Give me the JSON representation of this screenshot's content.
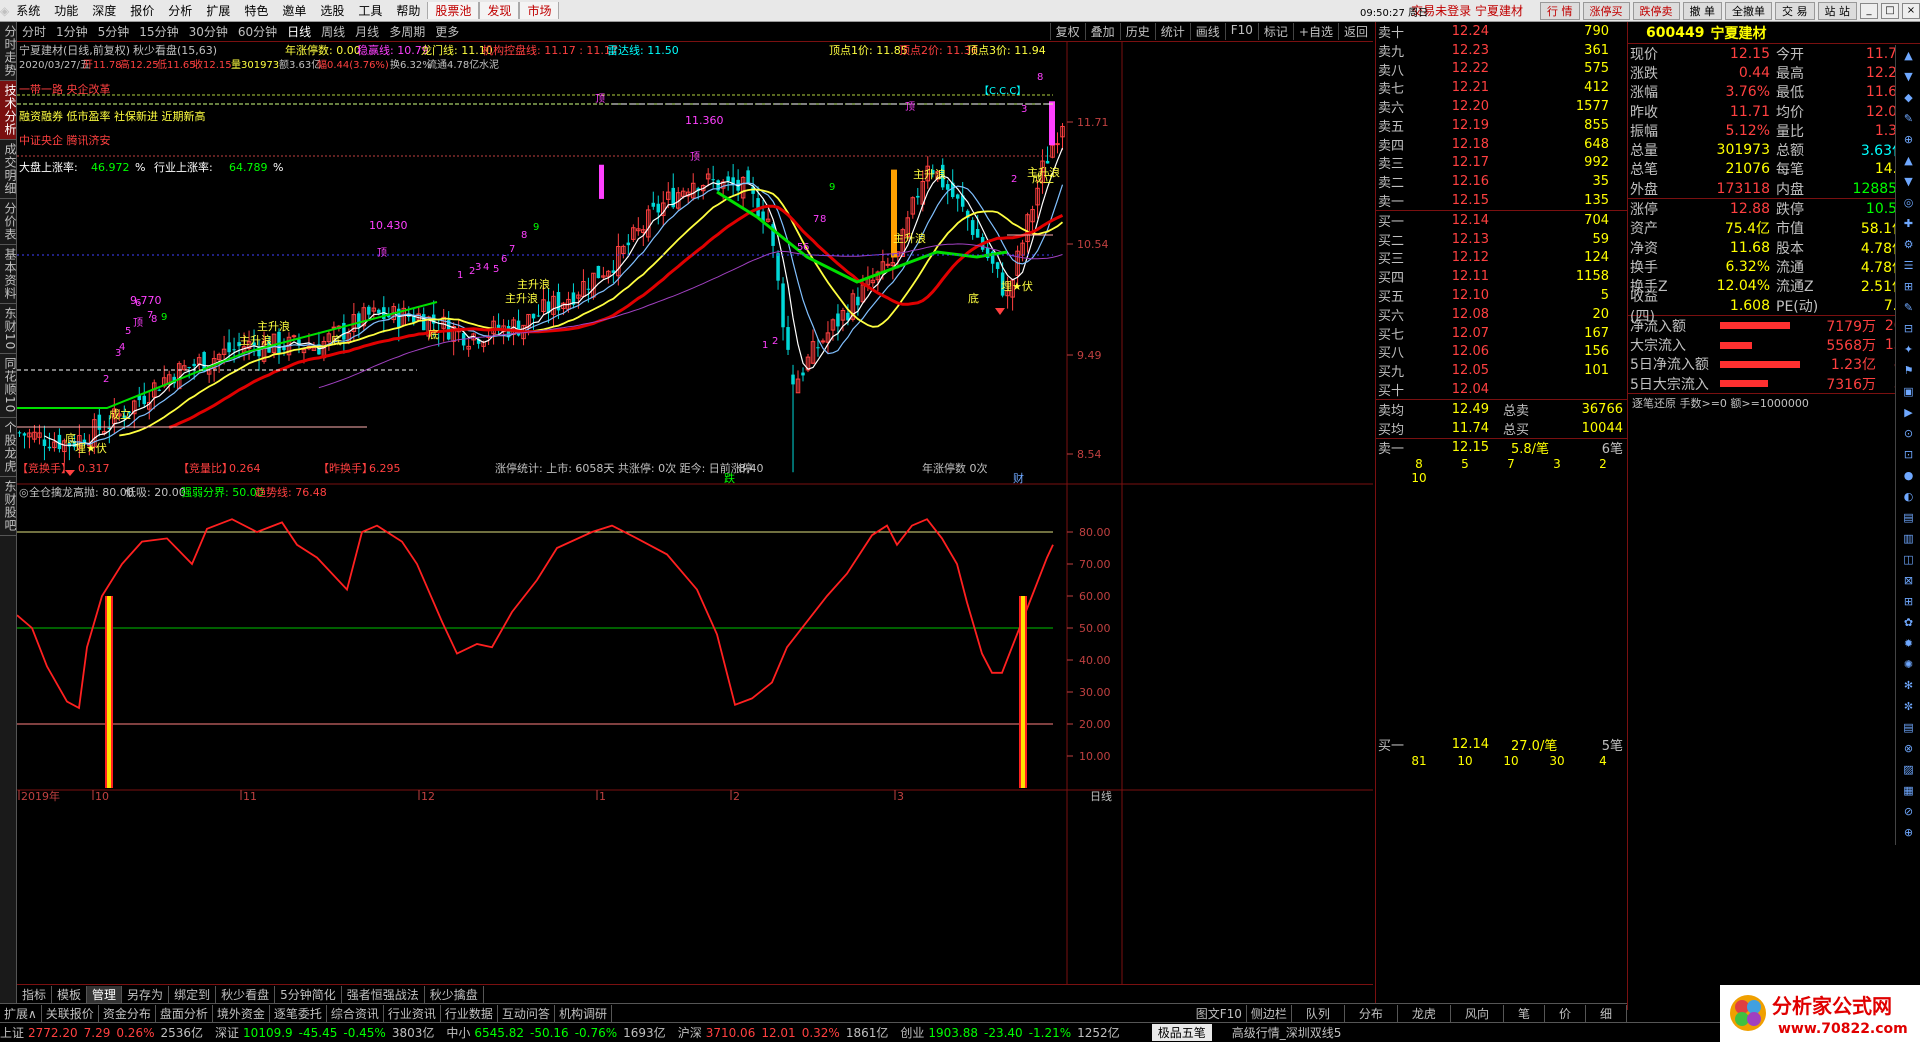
{
  "menu": {
    "items": [
      "系统",
      "功能",
      "深度",
      "报价",
      "分析",
      "扩展",
      "特色",
      "邀单",
      "选股",
      "工具",
      "帮助"
    ],
    "red_tabs": [
      "股票池",
      "发现",
      "市场"
    ],
    "status": "交易未登录 宁夏建材",
    "toolbar": [
      "行 情",
      "涨停买",
      "跌停卖",
      "撤 单",
      "全撤单",
      "交 易",
      "站 站"
    ],
    "clock": "09:50:27 周日"
  },
  "left_tabs": [
    "分时走势",
    "技术分析",
    "成交明细",
    "分价表",
    "基本资料",
    "东财10",
    "同花顺10",
    "个股龙虎",
    "东财股吧"
  ],
  "period_bar": {
    "periods": [
      "分时",
      "1分钟",
      "5分钟",
      "15分钟",
      "30分钟",
      "60分钟",
      "日线",
      "周线",
      "月线",
      "多周期",
      "更多"
    ],
    "selected": "日线",
    "right": [
      "复权",
      "叠加",
      "历史",
      "统计",
      "画线",
      "F10",
      "标记",
      "+自选",
      "返回"
    ]
  },
  "chart_header": {
    "title": "宁夏建材(日线,前复权)",
    "indicator": "秋少看盘(15,63)",
    "yr_limit": "年涨停数: 0.00",
    "stable": "稳赢线: 10.79",
    "dragon": "龙门线: 11.10",
    "inst": "机构控盘线: 11.17 : 11.17",
    "radar": "雷达线: 11.50",
    "top1": "顶点1价: 11.85",
    "top2": "顶点2价: 11.36",
    "top3": "顶点3价: 11.94",
    "date_line": "2020/03/27/五",
    "ohlc_open": "开11.78",
    "ohlc_high": "高12.25",
    "ohlc_low": "低11.65",
    "ohlc_close": "收12.15",
    "vol": "量301973",
    "amt": "额3.63亿",
    "chg": "幅0.44(3.76%)",
    "turn": "换6.32%",
    "float": "流通4.78亿",
    "sector": "水泥"
  },
  "concepts": {
    "line1": "一带一路 央企改革",
    "line2": "融资融券 低市盈率 社保新进 近期新高",
    "line3": "中证央企 腾讯济安",
    "market_up_label": "大盘上涨率:",
    "market_up": "46.972",
    "pct": "%",
    "industry_up_label": "行业上涨率:",
    "industry_up": "64.789"
  },
  "chart_notes": {
    "jing": "【竞换手】",
    "jing_v": "0.317",
    "liang": "【竞量比】",
    "liang_v": "0.264",
    "zuo": "【昨换手】",
    "zuo_v": "6.295",
    "stats": "涨停统计: 上市: 6058天 共涨停: 0次 距今: 日前涨停",
    "yr": "年涨停数 0次",
    "cai": "财",
    "die": "跌",
    "low": "8.40",
    "ceiling": "11.360",
    "p1": "10.430",
    "p2": "9.770",
    "badge": "【C.C.C】"
  },
  "main_axis": {
    "labels": [
      "11.71",
      "10.54",
      "9.49",
      "8.54"
    ]
  },
  "labels": {
    "zhushenglang": "主升浪",
    "di": "底",
    "ding": "顶",
    "chengli": "成立",
    "maifu": "埋★伏"
  },
  "sub_header": {
    "name": "全仓擒龙",
    "high": "高抛: 80.00",
    "low": "低吸: 20.00",
    "split": "强弱分界: 50.00",
    "trend": "趋势线: 76.48"
  },
  "sub_axis": {
    "labels": [
      "80.00",
      "70.00",
      "60.00",
      "50.00",
      "40.00",
      "30.00",
      "20.00",
      "10.00"
    ]
  },
  "x_axis": {
    "labels": [
      "2019年",
      "10",
      "11",
      "12",
      "1",
      "2",
      "3"
    ],
    "right": "日线"
  },
  "order_book": {
    "sells": [
      {
        "l": "卖十",
        "p": "12.24",
        "v": "790"
      },
      {
        "l": "卖九",
        "p": "12.23",
        "v": "361"
      },
      {
        "l": "卖八",
        "p": "12.22",
        "v": "575"
      },
      {
        "l": "卖七",
        "p": "12.21",
        "v": "412"
      },
      {
        "l": "卖六",
        "p": "12.20",
        "v": "1577"
      },
      {
        "l": "卖五",
        "p": "12.19",
        "v": "855"
      },
      {
        "l": "卖四",
        "p": "12.18",
        "v": "648"
      },
      {
        "l": "卖三",
        "p": "12.17",
        "v": "992"
      },
      {
        "l": "卖二",
        "p": "12.16",
        "v": "35"
      },
      {
        "l": "卖一",
        "p": "12.15",
        "v": "135"
      }
    ],
    "buys": [
      {
        "l": "买一",
        "p": "12.14",
        "v": "704"
      },
      {
        "l": "买二",
        "p": "12.13",
        "v": "59"
      },
      {
        "l": "买三",
        "p": "12.12",
        "v": "124"
      },
      {
        "l": "买四",
        "p": "12.11",
        "v": "1158"
      },
      {
        "l": "买五",
        "p": "12.10",
        "v": "5"
      },
      {
        "l": "买六",
        "p": "12.08",
        "v": "20"
      },
      {
        "l": "买七",
        "p": "12.07",
        "v": "167"
      },
      {
        "l": "买八",
        "p": "12.06",
        "v": "156"
      },
      {
        "l": "买九",
        "p": "12.05",
        "v": "101"
      },
      {
        "l": "买十",
        "p": "12.04"
      }
    ],
    "avg_sell_l": "卖均",
    "avg_sell_p": "12.49",
    "avg_sell_tl": "总卖",
    "avg_sell_tv": "36766",
    "avg_buy_l": "买均",
    "avg_buy_p": "11.74",
    "avg_buy_tl": "总买",
    "avg_buy_tv": "10044",
    "sell1_detail": {
      "l": "卖一",
      "p": "12.15",
      "lot": "5.8/笔",
      "cnt": "6笔",
      "q": [
        "8",
        "5",
        "7",
        "3",
        "2",
        "10"
      ]
    },
    "buy1_detail": {
      "l": "买一",
      "p": "12.14",
      "lot": "27.0/笔",
      "cnt": "5笔",
      "q": [
        "81",
        "10",
        "10",
        "30",
        "4"
      ]
    }
  },
  "quote": {
    "code": "600449",
    "name": "宁夏建材",
    "rows": [
      [
        "现价",
        "12.15",
        "今开",
        "11.78"
      ],
      [
        "涨跌",
        "0.44",
        "最高",
        "12.25"
      ],
      [
        "涨幅",
        "3.76%",
        "最低",
        "11.65"
      ],
      [
        "昨收",
        "11.71",
        "均价",
        "12.01"
      ],
      [
        "振幅",
        "5.12%",
        "量比",
        "1.31"
      ],
      [
        "总量",
        "301973",
        "总额",
        "3.63亿"
      ],
      [
        "总笔",
        "21076",
        "每笔",
        "14.3"
      ],
      [
        "外盘",
        "173118",
        "内盘",
        "128855"
      ]
    ],
    "rows2": [
      [
        "涨停",
        "12.88",
        "跌停",
        "10.54"
      ],
      [
        "资产",
        "75.4亿",
        "市值",
        "58.1亿"
      ],
      [
        "净资",
        "11.68",
        "股本",
        "4.78亿"
      ],
      [
        "换手",
        "6.32%",
        "流通",
        "4.78亿"
      ],
      [
        "换手Z",
        "12.04%",
        "流通Z",
        "2.51亿"
      ],
      [
        "收益(四)",
        "1.608",
        "PE(动)",
        "7.6"
      ]
    ],
    "flows": [
      [
        "净流入额",
        "7179万",
        "20%"
      ],
      [
        "大宗流入",
        "5568万",
        "15%"
      ],
      [
        "5日净流入额",
        "1.23亿",
        "8%"
      ],
      [
        "5日大宗流入",
        "7316万",
        "5%"
      ]
    ],
    "ticks_header": "逐笔还原 手数>=0 额>=1000000"
  },
  "bottom_tabs1": [
    "指标",
    "模板",
    "管理",
    "另存为",
    "绑定到",
    "秋少看盘",
    "5分钟简化",
    "强者恒强战法",
    "秋少擒盘"
  ],
  "bottom_tabs2": [
    "扩展∧",
    "关联报价",
    "资金分布",
    "盘面分析",
    "境外资金",
    "逐笔委托",
    "综合资讯",
    "行业资讯",
    "行业数据",
    "互动问答",
    "机构调研"
  ],
  "bottom_right": [
    "图文F10",
    "侧边栏"
  ],
  "bottom_right2": [
    "队列",
    "分布",
    "龙虎",
    "风向",
    "笔",
    "价",
    "细"
  ],
  "status_bar": [
    {
      "n": "上证",
      "v": "2772.20",
      "c": "7.29",
      "p": "0.26%",
      "a": "2536亿"
    },
    {
      "n": "深证",
      "v": "10109.9",
      "c": "-45.45",
      "p": "-0.45%",
      "a": "3803亿"
    },
    {
      "n": "中小",
      "v": "6545.82",
      "c": "-50.16",
      "p": "-0.76%",
      "a": "1693亿"
    },
    {
      "n": "沪深",
      "v": "3710.06",
      "c": "12.01",
      "p": "0.32%",
      "a": "1861亿"
    },
    {
      "n": "创业",
      "v": "1903.88",
      "c": "-23.40",
      "p": "-1.21%",
      "a": "1252亿"
    }
  ],
  "status_extra": "高级行情_深圳双线5",
  "pinbi": "极品五笔",
  "logo": {
    "text1": "分析家公式网",
    "text2": "www.70822.com"
  }
}
